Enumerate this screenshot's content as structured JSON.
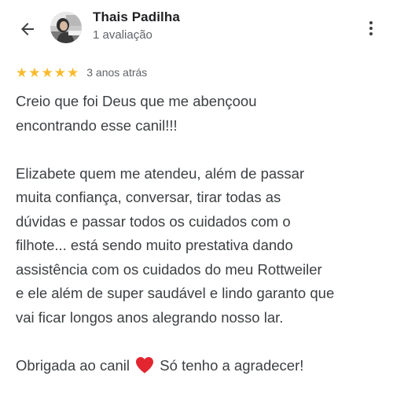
{
  "header": {
    "back_icon": "arrow-left-icon",
    "reviewer_name": "Thais Padilha",
    "review_count": "1 avaliação",
    "more_icon": "more-vertical-icon"
  },
  "review": {
    "rating": 5,
    "rating_max": 5,
    "star_color": "#f9bb2d",
    "date": "3 anos atrás",
    "paragraph_1": "Creio que foi Deus que me abençoou\nencontrando esse canil!!!",
    "paragraph_2": "Elizabete quem me atendeu, além de passar\nmuita confiança, conversar, tirar todas as\ndúvidas e passar todos os cuidados com o\nfilhote... está sendo muito prestativa dando\nassistência com os cuidados do meu Rottweiler\ne ele além de super saudável e lindo garanto que\nvai ficar longos anos alegrando nosso lar.",
    "closing_before": "Obrigada ao canil",
    "closing_icon": "red-heart-icon",
    "closing_after": "Só tenho a agradecer!"
  }
}
